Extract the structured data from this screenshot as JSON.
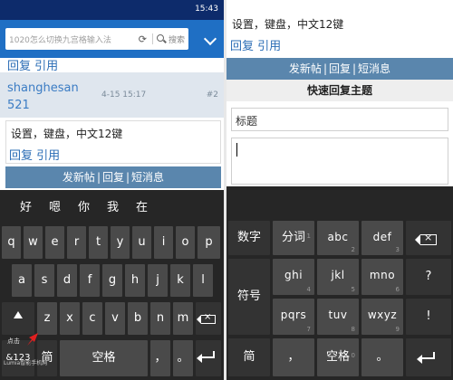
{
  "left": {
    "status_time": "15:43",
    "search": {
      "placeholder": "1020怎么切换九宫格输入法",
      "search_label": "搜索"
    },
    "reply_top": "回复 引用",
    "post": {
      "username_line1": "shanghesan",
      "username_line2": "521",
      "date": "4-15 15:17",
      "floor": "#2",
      "content": "设置，键盘，中文12键",
      "reply": "回复 引用"
    },
    "action_bar": {
      "new_post": "发新帖",
      "sep": "|",
      "reply": "回复",
      "message": "短消息"
    },
    "suggestions": [
      "好",
      "嗯",
      "你",
      "我",
      "在"
    ],
    "keyboard": {
      "row1": [
        "q",
        "w",
        "e",
        "r",
        "t",
        "y",
        "u",
        "i",
        "o",
        "p"
      ],
      "row2": [
        "a",
        "s",
        "d",
        "f",
        "g",
        "h",
        "j",
        "k",
        "l"
      ],
      "row3": [
        "z",
        "x",
        "c",
        "v",
        "b",
        "n",
        "m"
      ],
      "symbols_key": "&123",
      "lang_key": "简",
      "space_key": "空格",
      "comma_key": "，",
      "period_key": "。",
      "tap_hint": "点击"
    },
    "watermark": "Lumia智能手机网"
  },
  "right": {
    "content": "设置，键盘，中文12键",
    "reply": "回复 引用",
    "action_bar": {
      "new_post": "发新帖",
      "sep": "|",
      "reply": "回复",
      "message": "短消息"
    },
    "quick_reply_title": "快速回复主题",
    "title_field": "标题",
    "keyboard": {
      "digits_key": "数字",
      "word_key": "分词",
      "word_sub": "1",
      "abc": "abc",
      "abc_sub": "2",
      "def": "def",
      "def_sub": "3",
      "question_key": "?",
      "symbol_key": "符号",
      "ghi": "ghi",
      "ghi_sub": "4",
      "jkl": "jkl",
      "jkl_sub": "5",
      "mno": "mno",
      "mno_sub": "6",
      "pqrs": "pqrs",
      "pqrs_sub": "7",
      "tuv": "tuv",
      "tuv_sub": "8",
      "wxyz": "wxyz",
      "wxyz_sub": "9",
      "exclaim_key": "!",
      "lang_key": "简",
      "comma_key": "，",
      "space_key": "空格",
      "space_sub": "0",
      "period_key": "。"
    }
  }
}
